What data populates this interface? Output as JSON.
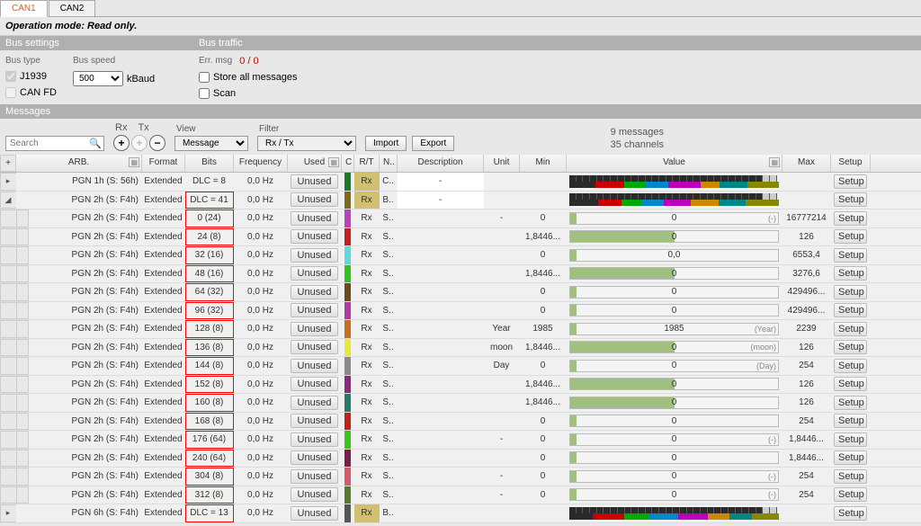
{
  "tabs": [
    "CAN1",
    "CAN2"
  ],
  "active_tab": 0,
  "mode": "Operation mode: Read only.",
  "bus_settings": {
    "title": "Bus settings",
    "bus_type_label": "Bus type",
    "bus_speed_label": "Bus speed",
    "j1939": "J1939",
    "canfd": "CAN FD",
    "speed": "500",
    "speed_unit": "kBaud"
  },
  "bus_traffic": {
    "title": "Bus traffic",
    "err_label": "Err. msg",
    "err_value": "0 / 0",
    "store_all": "Store all messages",
    "scan": "Scan"
  },
  "messages_title": "Messages",
  "toolbar": {
    "search_placeholder": "Search",
    "rx": "Rx",
    "tx": "Tx",
    "view": "View",
    "view_val": "Message",
    "filter": "Filter",
    "filter_val": "Rx / Tx",
    "import": "Import",
    "export": "Export",
    "info1": "9 messages",
    "info2": "35 channels"
  },
  "columns": [
    "+",
    "ARB.",
    "Format",
    "Bits",
    "Frequency",
    "Used",
    "C",
    "R/T",
    "N..",
    "Description",
    "Unit",
    "Min",
    "Value",
    "Max",
    "Setup"
  ],
  "rows": [
    {
      "type": "parent",
      "exp": "▸",
      "arb": "PGN 1h (S: 56h)",
      "fmt": "Extended",
      "bits": "DLC = 8",
      "freq": "0,0 Hz",
      "used": "Unused",
      "color": "#1a7a2a",
      "rt": "Rx",
      "n": "C..",
      "desc": "-",
      "setup": "Setup",
      "bits_hl": false
    },
    {
      "type": "parent",
      "exp": "◢",
      "arb": "PGN 2h (S: F4h)",
      "fmt": "Extended",
      "bits": "DLC = 41",
      "freq": "0,0 Hz",
      "used": "Unused",
      "color": "#7a6a1a",
      "rt": "Rx",
      "n": "B..",
      "desc": "-",
      "setup": "Setup",
      "bits_hl": true
    },
    {
      "type": "child",
      "arb": "PGN 2h (S: F4h)",
      "fmt": "Extended",
      "bits": "0 (24)",
      "freq": "0,0 Hz",
      "used": "Unused",
      "color": "#b943b9",
      "rt": "Rx",
      "n": "S..",
      "unit": "-",
      "min": "0",
      "val": "0",
      "ann": "(-)",
      "max": "16777214",
      "setup": "Setup",
      "fill": 3
    },
    {
      "type": "child",
      "arb": "PGN 2h (S: F4h)",
      "fmt": "Extended",
      "bits": "24 (8)",
      "freq": "0,0 Hz",
      "used": "Unused",
      "color": "#c41e1e",
      "rt": "Rx",
      "n": "S..",
      "unit": "",
      "min": "1,8446...",
      "val": "0",
      "max": "126",
      "setup": "Setup",
      "fill": 50
    },
    {
      "type": "child",
      "arb": "PGN 2h (S: F4h)",
      "fmt": "Extended",
      "bits": "32 (16)",
      "freq": "0,0 Hz",
      "used": "Unused",
      "color": "#5edada",
      "rt": "Rx",
      "n": "S..",
      "unit": "",
      "min": "0",
      "val": "0,0",
      "max": "6553,4",
      "setup": "Setup",
      "fill": 3
    },
    {
      "type": "child",
      "arb": "PGN 2h (S: F4h)",
      "fmt": "Extended",
      "bits": "48 (16)",
      "freq": "0,0 Hz",
      "used": "Unused",
      "color": "#34c21e",
      "rt": "Rx",
      "n": "S..",
      "unit": "",
      "min": "1,8446...",
      "val": "0",
      "max": "3276,6",
      "setup": "Setup",
      "fill": 50
    },
    {
      "type": "child",
      "arb": "PGN 2h (S: F4h)",
      "fmt": "Extended",
      "bits": "64 (32)",
      "freq": "0,0 Hz",
      "used": "Unused",
      "color": "#6a4a1a",
      "rt": "Rx",
      "n": "S..",
      "unit": "",
      "min": "0",
      "val": "0",
      "max": "429496...",
      "setup": "Setup",
      "fill": 3
    },
    {
      "type": "child",
      "arb": "PGN 2h (S: F4h)",
      "fmt": "Extended",
      "bits": "96 (32)",
      "freq": "0,0 Hz",
      "used": "Unused",
      "color": "#b13aa0",
      "rt": "Rx",
      "n": "S..",
      "unit": "",
      "min": "0",
      "val": "0",
      "max": "429496...",
      "setup": "Setup",
      "fill": 3
    },
    {
      "type": "child",
      "arb": "PGN 2h (S: F4h)",
      "fmt": "Extended",
      "bits": "128 (8)",
      "freq": "0,0 Hz",
      "used": "Unused",
      "color": "#c46e1e",
      "rt": "Rx",
      "n": "S..",
      "unit": "Year",
      "min": "1985",
      "val": "1985",
      "ann": "(Year)",
      "max": "2239",
      "setup": "Setup",
      "fill": 3
    },
    {
      "type": "child",
      "arb": "PGN 2h (S: F4h)",
      "fmt": "Extended",
      "bits": "136 (8)",
      "freq": "0,0 Hz",
      "used": "Unused",
      "color": "#e8e838",
      "rt": "Rx",
      "n": "S..",
      "unit": "moon",
      "min": "1,8446...",
      "val": "0",
      "ann": "(moon)",
      "max": "126",
      "setup": "Setup",
      "fill": 50
    },
    {
      "type": "child",
      "arb": "PGN 2h (S: F4h)",
      "fmt": "Extended",
      "bits": "144 (8)",
      "freq": "0,0 Hz",
      "used": "Unused",
      "color": "#8a8a8a",
      "rt": "Rx",
      "n": "S..",
      "unit": "Day",
      "min": "0",
      "val": "0",
      "ann": "(Day)",
      "max": "254",
      "setup": "Setup",
      "fill": 3
    },
    {
      "type": "child",
      "arb": "PGN 2h (S: F4h)",
      "fmt": "Extended",
      "bits": "152 (8)",
      "freq": "0,0 Hz",
      "used": "Unused",
      "color": "#8a2a7a",
      "rt": "Rx",
      "n": "S..",
      "unit": "",
      "min": "1,8446...",
      "val": "0",
      "max": "126",
      "setup": "Setup",
      "fill": 50
    },
    {
      "type": "child",
      "arb": "PGN 2h (S: F4h)",
      "fmt": "Extended",
      "bits": "160 (8)",
      "freq": "0,0 Hz",
      "used": "Unused",
      "color": "#2a7a6a",
      "rt": "Rx",
      "n": "S..",
      "unit": "",
      "min": "1,8446...",
      "val": "0",
      "max": "126",
      "setup": "Setup",
      "fill": 50
    },
    {
      "type": "child",
      "arb": "PGN 2h (S: F4h)",
      "fmt": "Extended",
      "bits": "168 (8)",
      "freq": "0,0 Hz",
      "used": "Unused",
      "color": "#c41e1e",
      "rt": "Rx",
      "n": "S..",
      "unit": "",
      "min": "0",
      "val": "0",
      "max": "254",
      "setup": "Setup",
      "fill": 3
    },
    {
      "type": "child",
      "arb": "PGN 2h (S: F4h)",
      "fmt": "Extended",
      "bits": "176 (64)",
      "freq": "0,0 Hz",
      "used": "Unused",
      "color": "#3ac41e",
      "rt": "Rx",
      "n": "S..",
      "unit": "-",
      "min": "0",
      "val": "0",
      "ann": "(-)",
      "max": "1,8446...",
      "setup": "Setup",
      "fill": 3
    },
    {
      "type": "child",
      "arb": "PGN 2h (S: F4h)",
      "fmt": "Extended",
      "bits": "240 (64)",
      "freq": "0,0 Hz",
      "used": "Unused",
      "color": "#7a1e4a",
      "rt": "Rx",
      "n": "S..",
      "unit": "",
      "min": "0",
      "val": "0",
      "max": "1,8446...",
      "setup": "Setup",
      "fill": 3
    },
    {
      "type": "child",
      "arb": "PGN 2h (S: F4h)",
      "fmt": "Extended",
      "bits": "304 (8)",
      "freq": "0,0 Hz",
      "used": "Unused",
      "color": "#d85a6a",
      "rt": "Rx",
      "n": "S..",
      "unit": "-",
      "min": "0",
      "val": "0",
      "ann": "(-)",
      "max": "254",
      "setup": "Setup",
      "fill": 3
    },
    {
      "type": "child",
      "arb": "PGN 2h (S: F4h)",
      "fmt": "Extended",
      "bits": "312 (8)",
      "freq": "0,0 Hz",
      "used": "Unused",
      "color": "#5a7a2a",
      "rt": "Rx",
      "n": "S..",
      "unit": "-",
      "min": "0",
      "val": "0",
      "ann": "(-)",
      "max": "254",
      "setup": "Setup",
      "fill": 3
    },
    {
      "type": "parent",
      "exp": "▸",
      "arb": "PGN 6h (S: F4h)",
      "fmt": "Extended",
      "bits": "DLC = 13",
      "freq": "0,0 Hz",
      "used": "Unused",
      "color": "#555",
      "rt": "Rx",
      "n": "B..",
      "desc": "",
      "setup": "Setup",
      "bits_hl": true
    }
  ]
}
